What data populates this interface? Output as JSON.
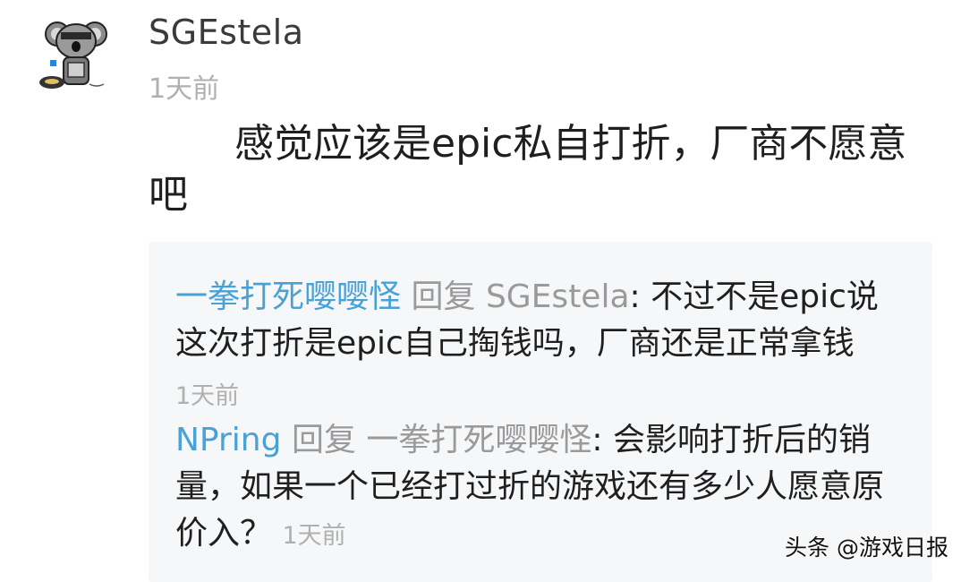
{
  "comment": {
    "username": "SGEstela",
    "timestamp": "1天前",
    "text": "感觉应该是epic私自打折，厂商不愿意吧"
  },
  "replies": [
    {
      "author": "一拳打死嘤嘤怪",
      "reply_word": "回复",
      "target": "SGEstela",
      "separator": ":",
      "text": "不过不是epic说这次打折是epic自己掏钱吗，厂商还是正常拿钱",
      "timestamp": "1天前"
    },
    {
      "author": "NPring",
      "reply_word": "回复",
      "target": "一拳打死嘤嘤怪",
      "separator": ":",
      "text": "会影响打折后的销量，如果一个已经打过折的游戏还有多少人愿意原价入？",
      "timestamp": "1天前"
    }
  ],
  "watermark": "头条 @游戏日报",
  "colors": {
    "link": "#4aa1d6",
    "timestamp": "#b0b0b0",
    "reply_background": "#f6f7f8"
  }
}
